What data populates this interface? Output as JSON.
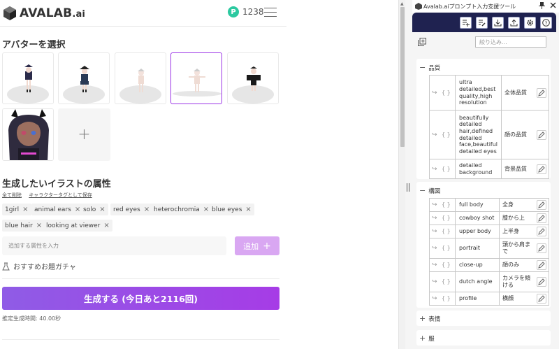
{
  "header": {
    "logo_text": "AVALAB",
    "logo_suffix": ".ai",
    "points_badge": "P",
    "points_value": "1238"
  },
  "avatar_section": {
    "title": "アバターを選択",
    "add_symbol": "+"
  },
  "attributes": {
    "title": "生成したいイラストの属性",
    "clear_all": "全て削除",
    "save_as_character": "キャラクタータグとして保存",
    "tags": [
      "1girl",
      "animal ears",
      "solo",
      "red eyes",
      "heterochromia",
      "blue eyes",
      "blue hair",
      "looking at viewer"
    ],
    "remove_symbol": "×",
    "input_placeholder": "追加する属性を入力",
    "add_button": "追加",
    "add_button_symbol": "+",
    "gacha": "おすすめお題ガチャ"
  },
  "generate": {
    "button": "生成する (今日あと2116回)",
    "estimated_time": "推定生成時間: 40.00秒"
  },
  "panel": {
    "title": "Avalab.aiプロンプト入力支援ツール",
    "filter_placeholder": "絞り込み...",
    "sections": [
      {
        "symbol": "−",
        "name": "品質",
        "rows": [
          {
            "en": "ultra detailed,best quality,high resolution",
            "jp": "全体品質"
          },
          {
            "en": "beautifully detailed hair,defined detailed face,beautiful detailed eyes",
            "jp": "顔の品質"
          },
          {
            "en": "detailed background",
            "jp": "背景品質"
          }
        ]
      },
      {
        "symbol": "−",
        "name": "構図",
        "rows": [
          {
            "en": "full body",
            "jp": "全身"
          },
          {
            "en": "cowboy shot",
            "jp": "膝から上"
          },
          {
            "en": "upper body",
            "jp": "上半身"
          },
          {
            "en": "portrait",
            "jp": "頭から肩まで"
          },
          {
            "en": "close-up",
            "jp": "顔のみ"
          },
          {
            "en": "dutch angle",
            "jp": "カメラを傾ける"
          },
          {
            "en": "profile",
            "jp": "横顔"
          }
        ]
      },
      {
        "symbol": "+",
        "name": "表情"
      },
      {
        "symbol": "+",
        "name": "服"
      }
    ],
    "row_icons": {
      "arrow": "↪",
      "braces": "{ }"
    }
  },
  "colors": {
    "accent_purple": "#9b34e6",
    "points_green": "#2cc9a0",
    "toolbar_navy": "#1f2250",
    "add_button": "#d9a7f2"
  },
  "icons": [
    "menu-icon",
    "plus-icon",
    "flask-icon",
    "pin-icon",
    "close-icon",
    "list-add-icon",
    "list-edit-icon",
    "download-icon",
    "upload-icon",
    "gear-icon",
    "help-icon",
    "copy-add-icon",
    "arrow-insert-icon",
    "braces-icon",
    "pencil-icon"
  ]
}
